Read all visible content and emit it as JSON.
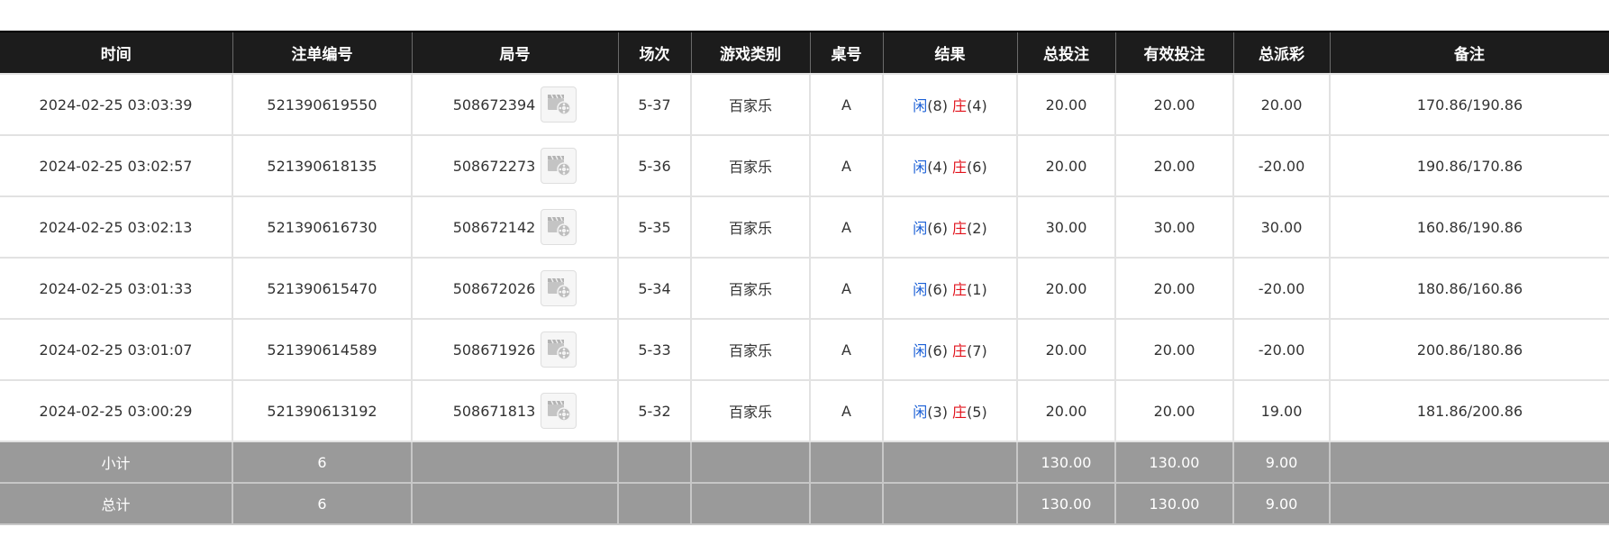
{
  "columns": {
    "time": "时间",
    "order_no": "注单编号",
    "round_no": "局号",
    "session": "场次",
    "game_type": "游戏类别",
    "table": "桌号",
    "result": "结果",
    "total_bet": "总投注",
    "valid_bet": "有效投注",
    "total_payout": "总派彩",
    "remark": "备注"
  },
  "result_labels": {
    "player": "闲",
    "banker": "庄"
  },
  "rows": [
    {
      "time": "2024-02-25 03:03:39",
      "order_no": "521390619550",
      "round_no": "508672394",
      "session": "5-37",
      "game_type": "百家乐",
      "table": "A",
      "player_score": "(8)",
      "banker_score": "(4)",
      "total_bet": "20.00",
      "valid_bet": "20.00",
      "total_payout": "20.00",
      "remark": "170.86/190.86"
    },
    {
      "time": "2024-02-25 03:02:57",
      "order_no": "521390618135",
      "round_no": "508672273",
      "session": "5-36",
      "game_type": "百家乐",
      "table": "A",
      "player_score": "(4)",
      "banker_score": "(6)",
      "total_bet": "20.00",
      "valid_bet": "20.00",
      "total_payout": "-20.00",
      "remark": "190.86/170.86"
    },
    {
      "time": "2024-02-25 03:02:13",
      "order_no": "521390616730",
      "round_no": "508672142",
      "session": "5-35",
      "game_type": "百家乐",
      "table": "A",
      "player_score": "(6)",
      "banker_score": "(2)",
      "total_bet": "30.00",
      "valid_bet": "30.00",
      "total_payout": "30.00",
      "remark": "160.86/190.86"
    },
    {
      "time": "2024-02-25 03:01:33",
      "order_no": "521390615470",
      "round_no": "508672026",
      "session": "5-34",
      "game_type": "百家乐",
      "table": "A",
      "player_score": "(6)",
      "banker_score": "(1)",
      "total_bet": "20.00",
      "valid_bet": "20.00",
      "total_payout": "-20.00",
      "remark": "180.86/160.86"
    },
    {
      "time": "2024-02-25 03:01:07",
      "order_no": "521390614589",
      "round_no": "508671926",
      "session": "5-33",
      "game_type": "百家乐",
      "table": "A",
      "player_score": "(6)",
      "banker_score": "(7)",
      "total_bet": "20.00",
      "valid_bet": "20.00",
      "total_payout": "-20.00",
      "remark": "200.86/180.86"
    },
    {
      "time": "2024-02-25 03:00:29",
      "order_no": "521390613192",
      "round_no": "508671813",
      "session": "5-32",
      "game_type": "百家乐",
      "table": "A",
      "player_score": "(3)",
      "banker_score": "(5)",
      "total_bet": "20.00",
      "valid_bet": "20.00",
      "total_payout": "19.00",
      "remark": "181.86/200.86"
    }
  ],
  "subtotal": {
    "label": "小计",
    "count": "6",
    "total_bet": "130.00",
    "valid_bet": "130.00",
    "total_payout": "9.00"
  },
  "grand_total": {
    "label": "总计",
    "count": "6",
    "total_bet": "130.00",
    "valid_bet": "130.00",
    "total_payout": "9.00"
  },
  "icons": {
    "replay": "video-replay-icon"
  },
  "colors": {
    "header_bg": "#1c1c1c",
    "totals_bg": "#9a9a9a",
    "player_blue": "#1a5fd6",
    "banker_red": "#e1121b",
    "negative_red": "#e1121b"
  }
}
